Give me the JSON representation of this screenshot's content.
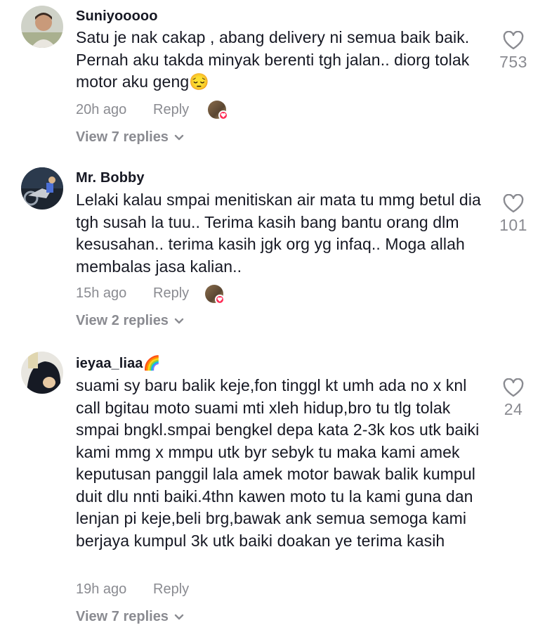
{
  "comments": [
    {
      "username": "Suniyooooo",
      "text": "Satu je nak cakap , abang delivery ni semua baik baik. Pernah aku takda minyak berenti tgh jalan.. diorg tolak motor aku geng😔",
      "time": "20h ago",
      "reply_label": "Reply",
      "view_replies": "View 7 replies",
      "likes": "753"
    },
    {
      "username": "Mr. Bobby",
      "text": "Lelaki kalau smpai menitiskan air mata tu mmg betul dia tgh susah la tuu.. Terima kasih bang bantu orang dlm kesusahan.. terima kasih jgk org yg infaq.. Moga allah membalas jasa kalian..",
      "time": "15h ago",
      "reply_label": "Reply",
      "view_replies": "View 2 replies",
      "likes": "101"
    },
    {
      "username": "ieyaa_liaa🌈",
      "text": "suami sy baru balik keje,fon tinggl kt umh ada no x knl call bgitau moto suami mti xleh hidup,bro tu tlg tolak smpai bngkl.smpai bengkel depa kata 2-3k kos utk baiki kami mmg x mmpu utk byr sebyk tu maka kami amek keputusan panggil lala amek motor bawak balik kumpul duit dlu nnti baiki.4thn kawen moto tu la kami guna dan lenjan pi keje,beli brg,bawak ank semua semoga kami berjaya kumpul 3k utk baiki doakan ye terima kasih",
      "time": "19h ago",
      "reply_label": "Reply",
      "view_replies": "View 7 replies",
      "likes": "24"
    }
  ],
  "icons": {
    "like": "heart-outline-icon",
    "expand": "chevron-down-icon",
    "creator_liked": "creator-liked-heart-icon"
  },
  "colors": {
    "text": "#161823",
    "secondary": "#8a8b91",
    "accent": "#fe2c55"
  }
}
